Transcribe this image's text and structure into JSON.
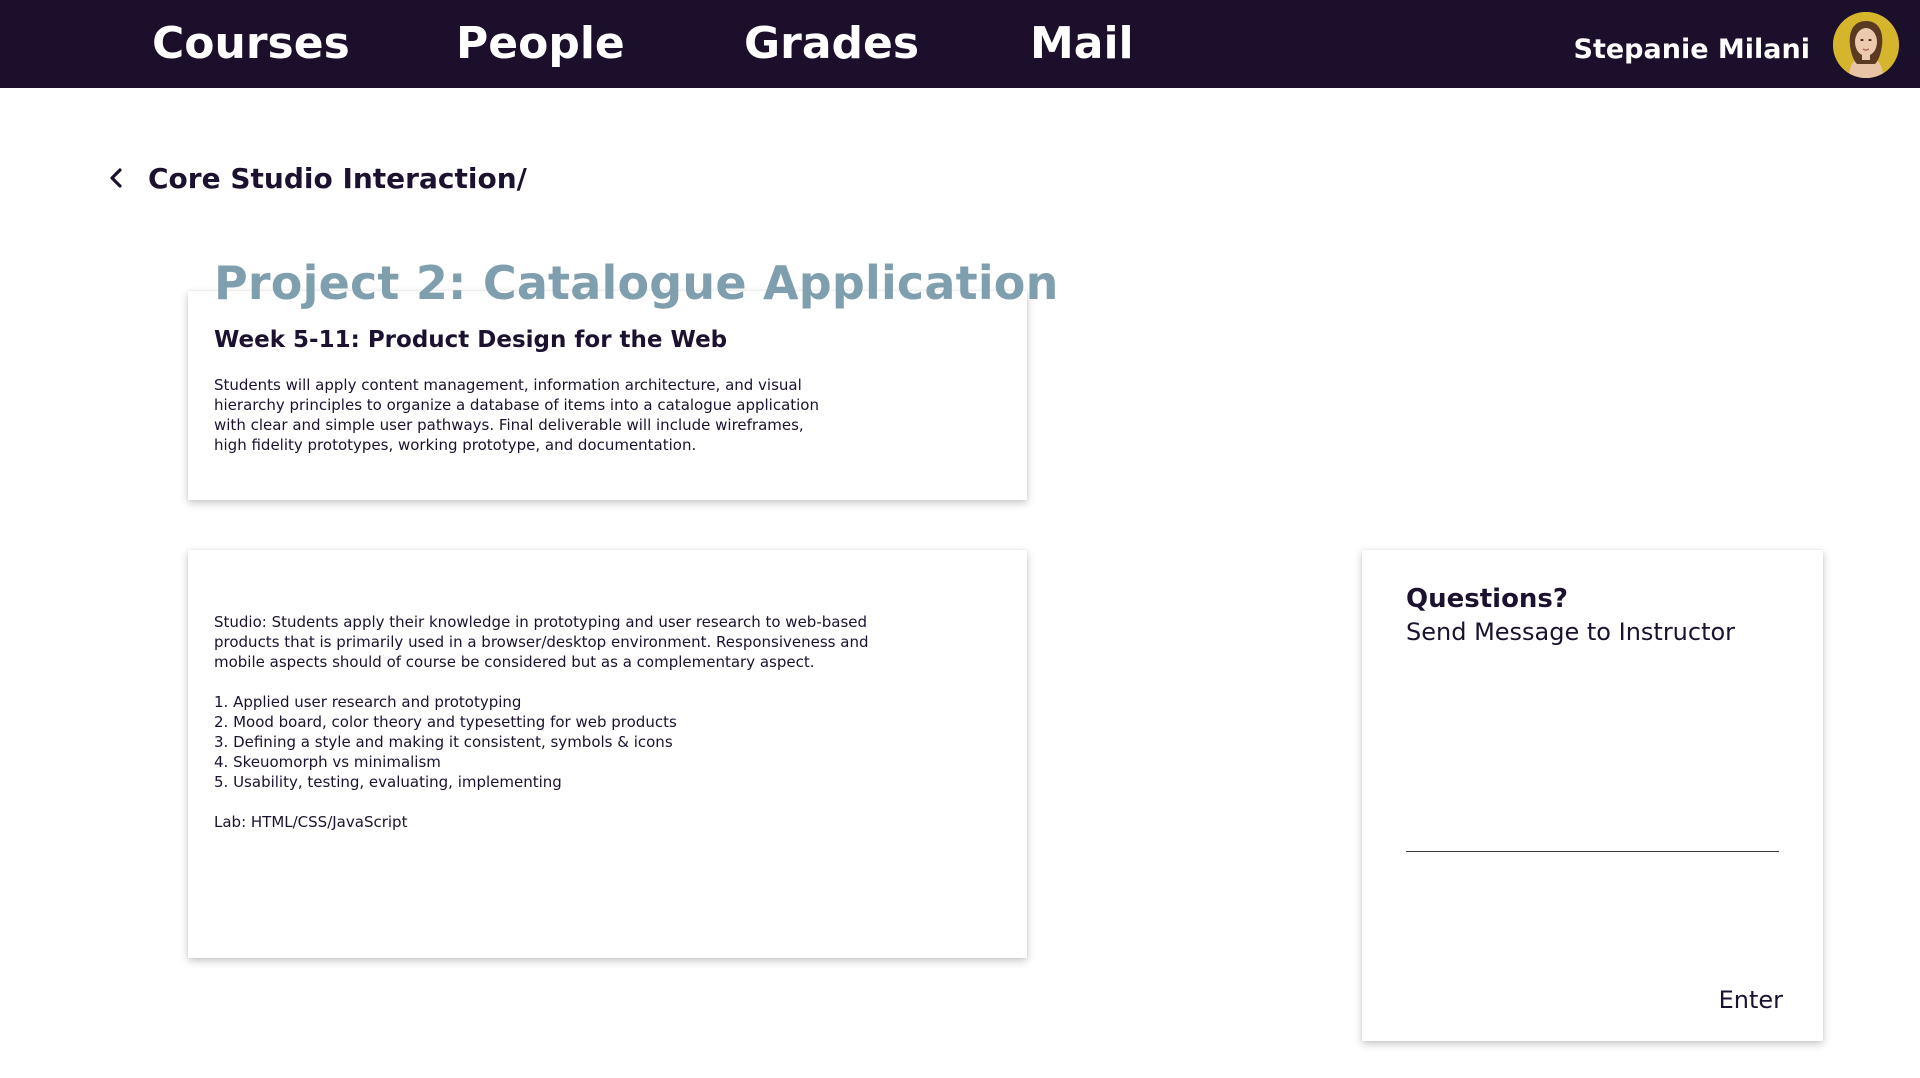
{
  "nav": {
    "items": [
      {
        "label": "Courses"
      },
      {
        "label": "People"
      },
      {
        "label": "Grades"
      },
      {
        "label": "Mail"
      }
    ],
    "user_name": "Stepanie Milani",
    "background": "#1c0f2b"
  },
  "breadcrumb": {
    "icon": "chevron-left-icon",
    "label": "Core Studio Interaction/"
  },
  "project": {
    "title": "Project 2: Catalogue Application",
    "title_color": "#7f9fae"
  },
  "week_card": {
    "title": "Week 5-11: Product Design for the Web",
    "description": "Students will apply content management, information architecture, and visual hierarchy principles to organize a database of items into a catalogue application with clear and simple user pathways. Final deliverable will include wireframes, high fidelity prototypes, working prototype, and documentation."
  },
  "studio_card": {
    "intro": "Studio: Students apply their knowledge in prototyping and user research to web-based products that is primarily used in a browser/desktop environment. Responsiveness and mobile aspects should of course be considered but as a complementary aspect.",
    "topics": [
      "1. Applied user research and prototyping",
      "2. Mood board, color theory and typesetting for web products",
      "3. Defining a style and making it consistent, symbols & icons",
      "4. Skeuomorph vs minimalism",
      "5. Usability, testing, evaluating, implementing"
    ],
    "lab": "Lab: HTML/CSS/JavaScript"
  },
  "questions_card": {
    "title": "Questions?",
    "subtitle": "Send Message to Instructor",
    "input_value": "",
    "enter_label": "Enter"
  }
}
